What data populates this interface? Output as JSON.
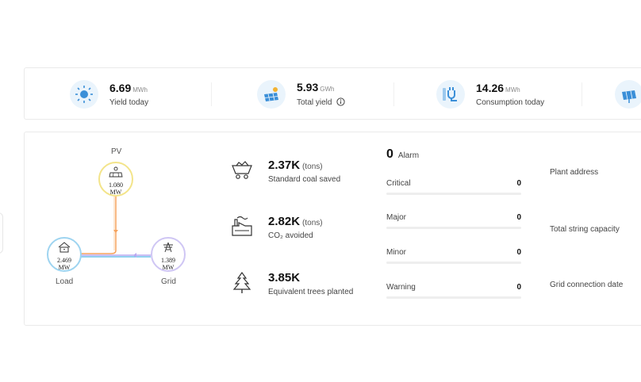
{
  "kpis": [
    {
      "value": "6.69",
      "unit": "MWh",
      "label": "Yield today",
      "icon": "sun-icon",
      "info": false
    },
    {
      "value": "5.93",
      "unit": "GWh",
      "label": "Total yield",
      "icon": "solar-panel-icon",
      "info": true
    },
    {
      "value": "14.26",
      "unit": "MWh",
      "label": "Consumption today",
      "icon": "plug-icon",
      "info": false
    },
    {
      "icon": "solar-panel-icon"
    }
  ],
  "flow": {
    "pv": {
      "label": "PV",
      "value_line1": "1.080",
      "value_line2": "MW"
    },
    "load": {
      "label": "Load",
      "value_line1": "2.469",
      "value_line2": "MW"
    },
    "grid": {
      "label": "Grid",
      "value_line1": "1.389",
      "value_line2": "MW"
    }
  },
  "eco": [
    {
      "value": "2.37K",
      "unit": "(tons)",
      "label": "Standard coal saved",
      "icon": "coal-cart-icon"
    },
    {
      "value": "2.82K",
      "unit": "(tons)",
      "label": "CO₂ avoided",
      "icon": "factory-icon"
    },
    {
      "value": "3.85K",
      "unit": "",
      "label": "Equivalent trees planted",
      "icon": "tree-icon"
    }
  ],
  "alarm": {
    "count": "0",
    "label": "Alarm",
    "rows": [
      {
        "name": "Critical",
        "count": "0"
      },
      {
        "name": "Major",
        "count": "0"
      },
      {
        "name": "Minor",
        "count": "0"
      },
      {
        "name": "Warning",
        "count": "0"
      }
    ]
  },
  "plant_info": [
    "Plant address",
    "Total string capacity",
    "Grid connection date"
  ],
  "colors": {
    "pv_line": "#f5a25d",
    "load_line": "#4fb3e8",
    "grid_line": "#b9a8f0",
    "pv_ring": "#f3e48a",
    "load_ring": "#9ed4f0",
    "grid_ring": "#cfc6f4"
  }
}
